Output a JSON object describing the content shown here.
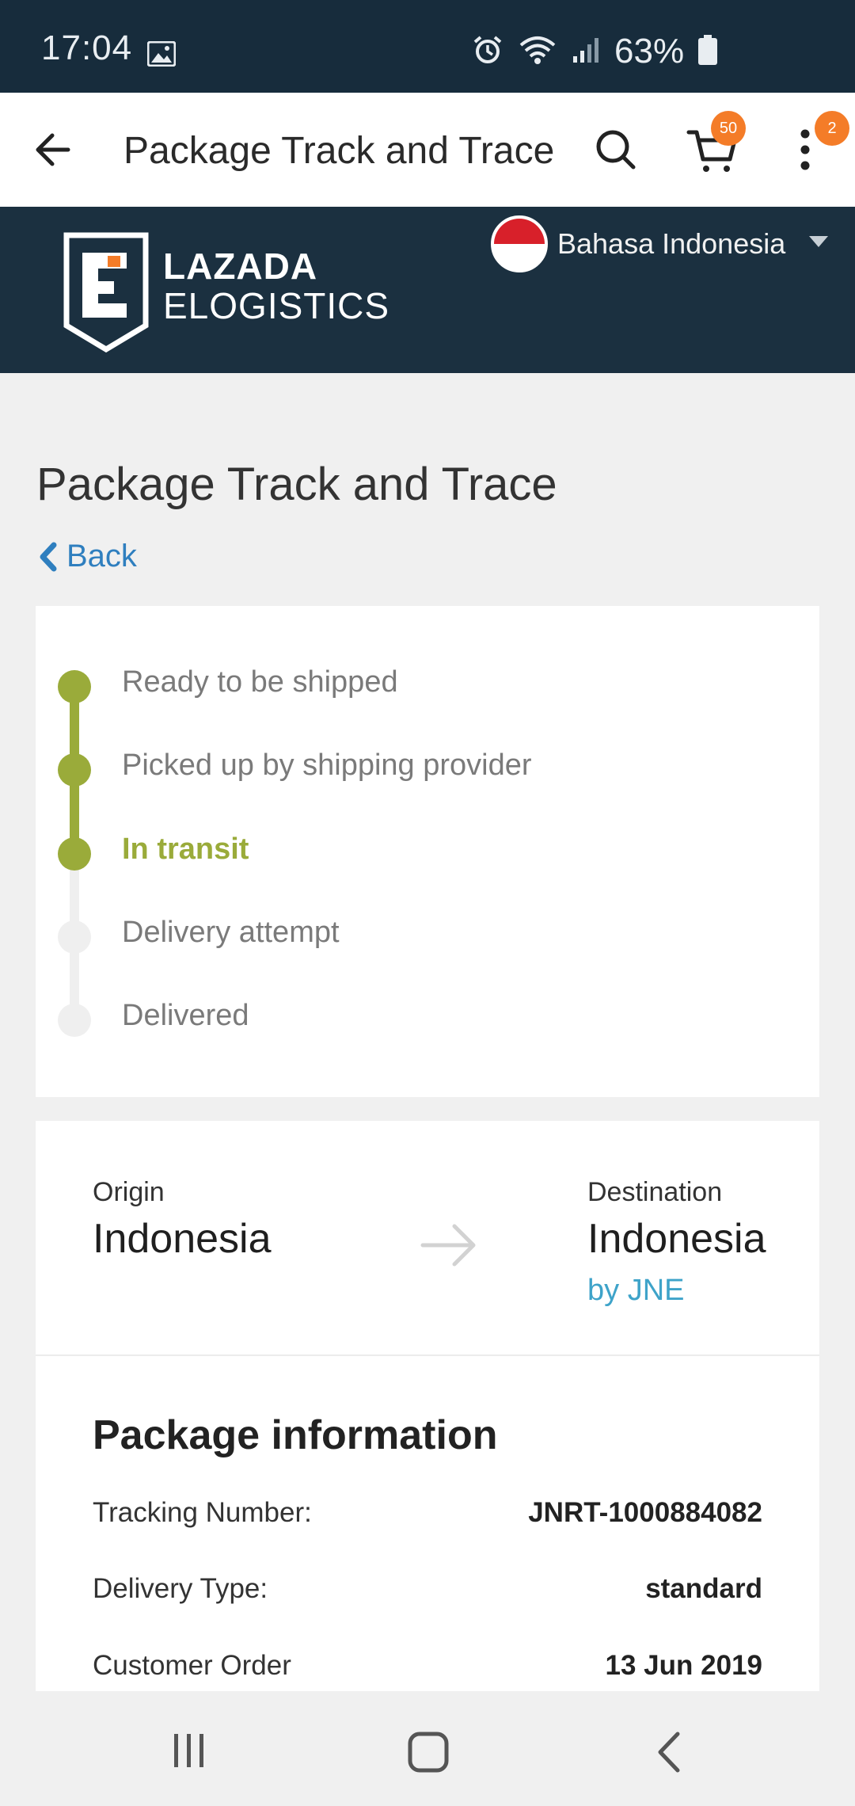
{
  "status_bar": {
    "time": "17:04",
    "battery": "63%",
    "icons": [
      "gallery-icon",
      "alarm-icon",
      "wifi-icon",
      "signal-icon",
      "battery-icon"
    ]
  },
  "app_bar": {
    "title": "Package Track and Trace",
    "cart_badge": "50",
    "more_badge": "2",
    "accent_color": "#f47c28"
  },
  "brand_header": {
    "logo_line1": "LAZADA",
    "logo_line2": "ELOGISTICS",
    "language": "Bahasa Indonesia",
    "background": "#1b3040"
  },
  "page": {
    "title": "Package Track and Trace",
    "back_label": "Back"
  },
  "timeline": {
    "accent_color": "#9aab3a",
    "steps": [
      {
        "label": "Ready to be shipped",
        "state": "done"
      },
      {
        "label": "Picked up by shipping provider",
        "state": "done"
      },
      {
        "label": "In transit",
        "state": "current"
      },
      {
        "label": "Delivery attempt",
        "state": "pending"
      },
      {
        "label": "Delivered",
        "state": "pending"
      }
    ]
  },
  "route": {
    "origin_label": "Origin",
    "origin": "Indonesia",
    "destination_label": "Destination",
    "destination": "Indonesia",
    "carrier": "by JNE"
  },
  "package_info": {
    "heading": "Package information",
    "rows": [
      {
        "label": "Tracking Number:",
        "value": "JNRT-1000884082"
      },
      {
        "label": "Delivery Type:",
        "value": "standard"
      },
      {
        "label": "Customer Order",
        "value": "13 Jun 2019"
      }
    ]
  }
}
